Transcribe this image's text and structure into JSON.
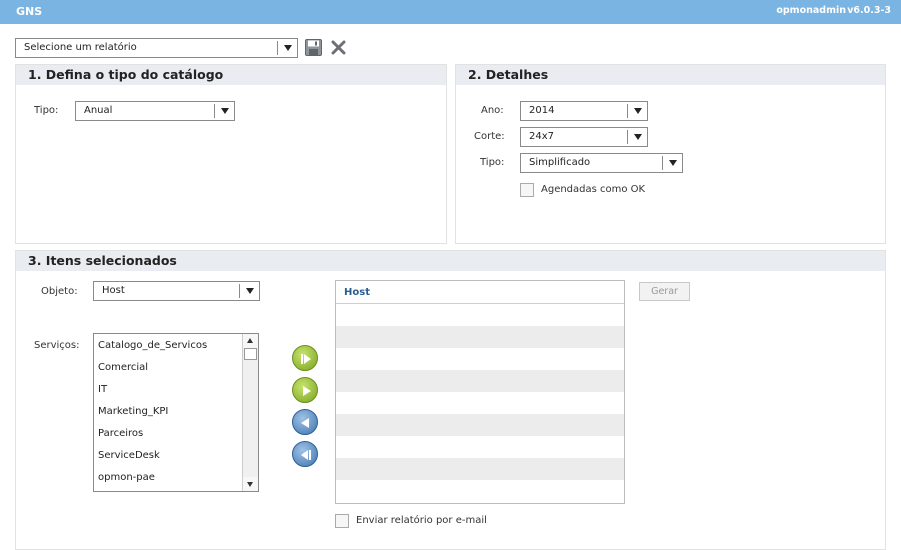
{
  "header": {
    "app_title": "GNS",
    "user": "opmonadmin",
    "version": "v6.0.3-3"
  },
  "report_select": {
    "value": "Selecione um relatório"
  },
  "section1": {
    "title": "1. Defina o tipo do catálogo",
    "tipo_label": "Tipo:",
    "tipo_value": "Anual"
  },
  "section2": {
    "title": "2. Detalhes",
    "ano_label": "Ano:",
    "ano_value": "2014",
    "corte_label": "Corte:",
    "corte_value": "24x7",
    "tipo_label": "Tipo:",
    "tipo_value": "Simplificado",
    "agendadas_label": "Agendadas como OK"
  },
  "section3": {
    "title": "3. Itens selecionados",
    "objeto_label": "Objeto:",
    "objeto_value": "Host",
    "servicos_label": "Serviços:",
    "services": [
      "Catalogo_de_Servicos",
      "Comercial",
      "IT",
      "Marketing_KPI",
      "Parceiros",
      "ServiceDesk",
      "opmon-pae"
    ],
    "grid_header": "Host",
    "generate_label": "Gerar",
    "email_label": "Enviar relatório por e-mail"
  }
}
